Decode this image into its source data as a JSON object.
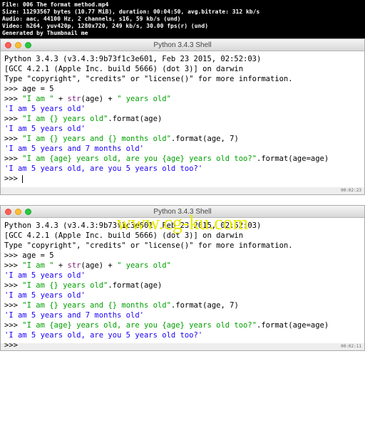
{
  "header": {
    "file_label": "File:",
    "file_value": "006 The format method.mp4",
    "size_label": "Size:",
    "size_value": "11293567 bytes (10.77 MiB), duration: 00:04:50, avg.bitrate: 312 kb/s",
    "audio_label": "Audio:",
    "audio_value": "aac, 44100 Hz, 2 channels, s16, 59 kb/s (und)",
    "video_label": "Video:",
    "video_value": "h264, yuv420p, 1280x720, 249 kb/s, 30.00 fps(r) (und)",
    "generated": "Generated by Thumbnail me"
  },
  "window": {
    "title": "Python 3.4.3 Shell",
    "version_line": "Python 3.4.3 (v3.4.3:9b73f1c3e601, Feb 23 2015, 02:52:03)",
    "gcc_line": "[GCC 4.2.1 (Apple Inc. build 5666) (dot 3)] on darwin",
    "help_line": "Type \"copyright\", \"credits\" or \"license()\" for more information.",
    "prompt": ">>>",
    "lines": {
      "l1_a": "age = ",
      "l1_b": "5",
      "l2_a": "\"I am \"",
      "l2_b": " + ",
      "l2_c": "str",
      "l2_d": "(age) + ",
      "l2_e": "\" years old\"",
      "r2": "'I am 5 years old'",
      "l3_a": "\"I am {} years old\"",
      "l3_b": ".format(age)",
      "r3": "'I am 5 years old'",
      "l4_a": "\"I am {} years and {} months old\"",
      "l4_b": ".format(age, ",
      "l4_c": "7",
      "l4_d": ")",
      "r4": "'I am 5 years and 7 months old'",
      "l5_a": "\"I am {age} years old, are you {age} years old too?\"",
      "l5_b": ".format(age=age)",
      "r5": "'I am 5 years old, are you 5 years old too?'"
    }
  },
  "watermark": "www.cg-ku.com",
  "timestamps": {
    "t1": "00:02:23",
    "t2": "00:02:11"
  }
}
